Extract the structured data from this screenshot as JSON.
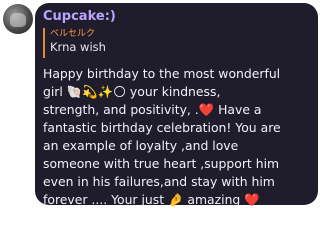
{
  "message": {
    "sender": "Cupcake:)",
    "reply": {
      "author": "ベルセルク",
      "text": "Krna wish"
    },
    "lines": [
      "Happy birthday to the most wonderful",
      "girl 🐚💫✨🌕 your kindness,",
      "strength, and positivity, .❤️ Have a",
      "fantastic birthday celebration! You are",
      "an example of loyalty ,and love",
      "someone with true heart ,support him",
      "even in his failures,and stay with him",
      "forever ....  Your just 🤌 amazing ❤️"
    ],
    "avatar_icon": "profile-avatar"
  },
  "colors": {
    "bubble": "#1f1d2c",
    "sender": "#b9a4ff",
    "reply_bar": "#e08a3c",
    "reply_author": "#ff9a45",
    "text": "#f2f1f7"
  }
}
